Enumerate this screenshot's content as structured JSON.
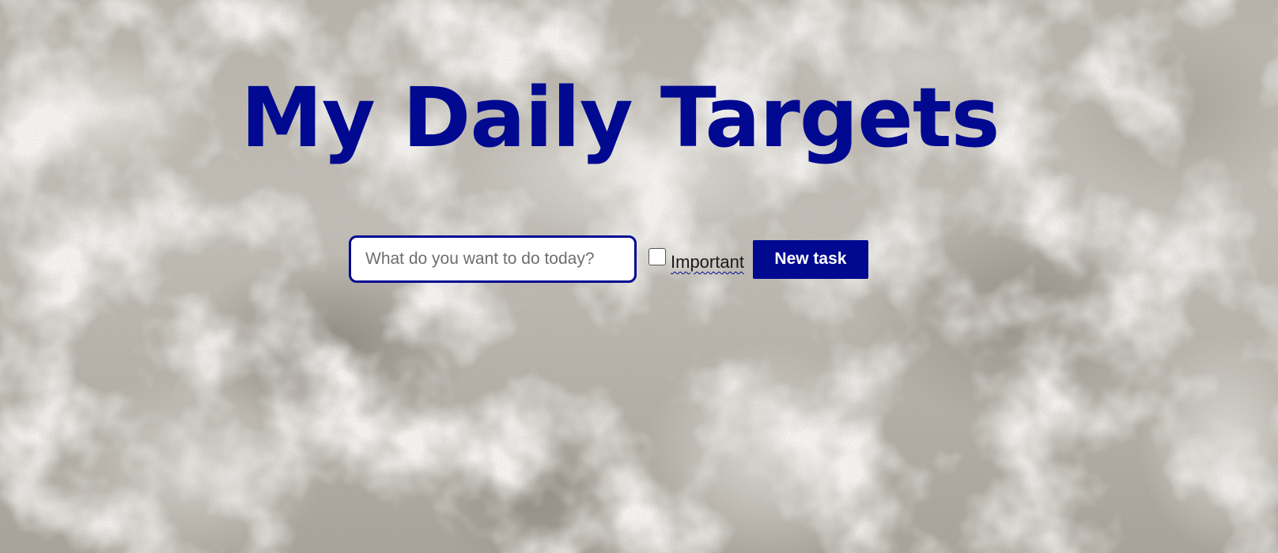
{
  "page": {
    "title": "My Daily Targets",
    "background": "concrete-texture"
  },
  "form": {
    "input_placeholder": "What do you want to do today?",
    "input_value": "",
    "important_label": "Important",
    "important_checked": false,
    "submit_label": "New task"
  },
  "colors": {
    "accent": "#000990",
    "text": "#1a1a1a",
    "input_background": "#ffffff"
  }
}
